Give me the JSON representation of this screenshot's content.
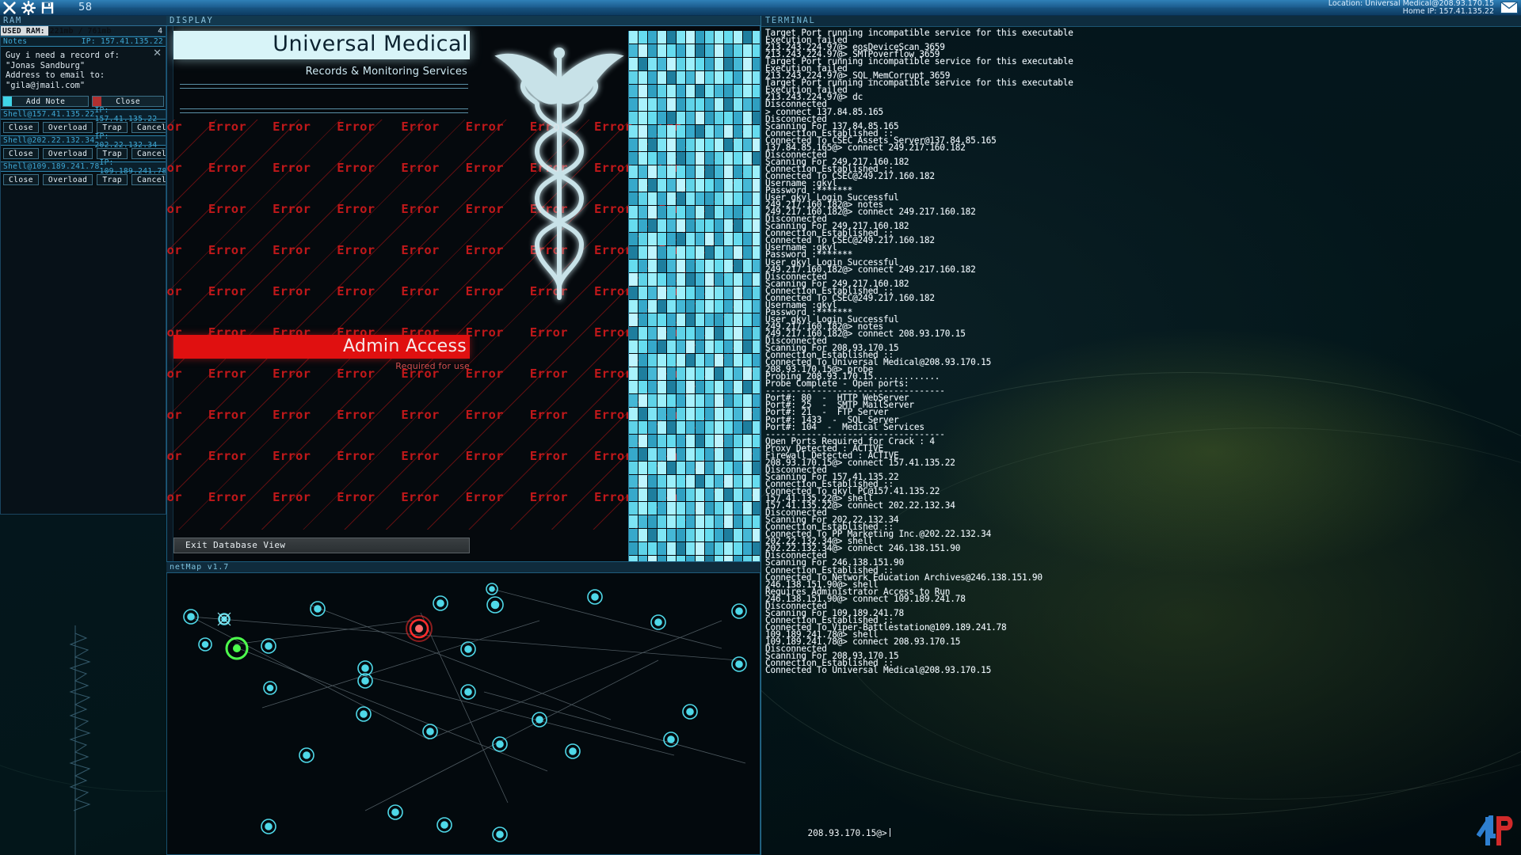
{
  "topbar": {
    "time": "58",
    "location_label": "Location: Universal Medical@208.93.170.15",
    "home_label": "Home IP: 157.41.135.22",
    "icons": [
      "close-icon",
      "settings-gear-icon",
      "save-disk-icon",
      "mail-icon"
    ]
  },
  "ram": {
    "title": "RAM",
    "used_label": "USED RAM: 221mb / 761mb",
    "count": "4",
    "used_pct": 29,
    "modules": [
      {
        "name": "Notes",
        "ip_label": "IP: 157.41.135.22",
        "type": "note",
        "note_lines": [
          "Guy i need a record of:",
          "\"Jonas Sandburg\"",
          "Address to email to:",
          "\"gila@jmail.com\""
        ],
        "buttons": [
          "Add Note",
          "Close"
        ]
      },
      {
        "name": "Shell@157.41.135.22",
        "ip_label": "IP: 157.41.135.22",
        "type": "shell",
        "buttons": [
          "Close",
          "Overload",
          "Trap",
          "Cancel"
        ]
      },
      {
        "name": "Shell@202.22.132.34",
        "ip_label": "IP: 202.22.132.34",
        "type": "shell",
        "buttons": [
          "Close",
          "Overload",
          "Trap",
          "Cancel"
        ]
      },
      {
        "name": "Shell@109.189.241.78",
        "ip_label": "IP: 109.189.241.78",
        "type": "shell",
        "buttons": [
          "Close",
          "Overload",
          "Trap",
          "Cancel"
        ]
      }
    ]
  },
  "display": {
    "title": "DISPLAY",
    "org_name": "Universal Medical",
    "org_sub": "Records & Monitoring Services",
    "error_text": "Error",
    "error_text_clipped": "ror",
    "error_text_trailing": "Err",
    "admin_banner": "Admin Access",
    "admin_note": "Required for use",
    "exit_button": "Exit Database View",
    "accent_red": "#e01010",
    "accent_cyan": "#d8f4f8"
  },
  "netmap": {
    "title": "netMap v1.7",
    "node_colors": {
      "normal": "#4fd8e8",
      "target": "#ff2d2d",
      "home": "#4dff4d"
    }
  },
  "terminal": {
    "title": "TERMINAL",
    "prompt": "208.93.170.15@>",
    "lines": [
      "Target Port running incompatible service for this executable",
      "Execution failed",
      "213.243.224.97@> eosDeviceScan 3659",
      "213.243.224.97@> SMTPoverflow 3659",
      "Target Port running incompatible service for this executable",
      "Execution failed",
      "213.243.224.97@> SQL_MemCorrupt 3659",
      "Target Port running incompatible service for this executable",
      "Execution failed",
      "213.243.224.97@> dc",
      "Disconnected",
      "> connect 137.84.85.165",
      "Disconnected",
      "Scanning For 137.84.85.165",
      "Connection Established ::",
      "Connected To CSEC Assets Server@137.84.85.165",
      "137.84.85.165@> connect 249.217.160.182",
      "Disconnected",
      "Scanning For 249.217.160.182",
      "Connection Established ::",
      "Connected To CSEC@249.217.160.182",
      "Username :gkyl",
      "Password :*******",
      "User gkyl Login Successful",
      "249.217.160.182@> notes",
      "249.217.160.182@> connect 249.217.160.182",
      "Disconnected",
      "Scanning For 249.217.160.182",
      "Connection Established ::",
      "Connected To CSEC@249.217.160.182",
      "Username :gkyl",
      "Password :*******",
      "User gkyl Login Successful",
      "249.217.160.182@> connect 249.217.160.182",
      "Disconnected",
      "Scanning For 249.217.160.182",
      "Connection Established ::",
      "Connected To CSEC@249.217.160.182",
      "Username :gkyl",
      "Password :*******",
      "User gkyl Login Successful",
      "249.217.160.182@> notes",
      "249.217.160.182@> connect 208.93.170.15",
      "Disconnected",
      "Scanning For 208.93.170.15",
      "Connection Established ::",
      "Connected To Universal Medical@208.93.170.15",
      "208.93.170.15@> probe",
      "Probing 208.93.170.15.............",
      "Probe Complete - Open ports:",
      "-----------------------------------",
      "Port#: 80  -  HTTP WebServer",
      "Port#: 25  -  SMTP MailServer",
      "Port#: 21  -  FTP Server",
      "Port#: 1433  -  SQL Server",
      "Port#: 104  -  Medical Services",
      "-----------------------------------",
      "Open Ports Required for Crack : 4",
      "Proxy Detected : ACTIVE",
      "Firewall Detected : ACTIVE",
      "208.93.170.15@> connect 157.41.135.22",
      "Disconnected",
      "Scanning For 157.41.135.22",
      "Connection Established ::",
      "Connected To gkyl PC@157.41.135.22",
      "157.41.135.22@> shell",
      "157.41.135.22@> connect 202.22.132.34",
      "Disconnected",
      "Scanning For 202.22.132.34",
      "Connection Established ::",
      "Connected To PP Marketing Inc.@202.22.132.34",
      "202.22.132.34@> shell",
      "202.22.132.34@> connect 246.138.151.90",
      "Disconnected",
      "Scanning For 246.138.151.90",
      "Connection Established ::",
      "Connected To Network Education Archives@246.138.151.90",
      "246.138.151.90@> shell",
      "Requires Administrator Access to Run",
      "246.138.151.90@> connect 109.189.241.78",
      "Disconnected",
      "Scanning For 109.189.241.78",
      "Connection Established ::",
      "Connected To Viper-Battlestation@109.189.241.78",
      "109.189.241.78@> shell",
      "109.189.241.78@> connect 208.93.170.15",
      "Disconnected",
      "Scanning For 208.93.170.15",
      "Connection Established ::",
      "Connected To Universal Medical@208.93.170.15"
    ]
  }
}
